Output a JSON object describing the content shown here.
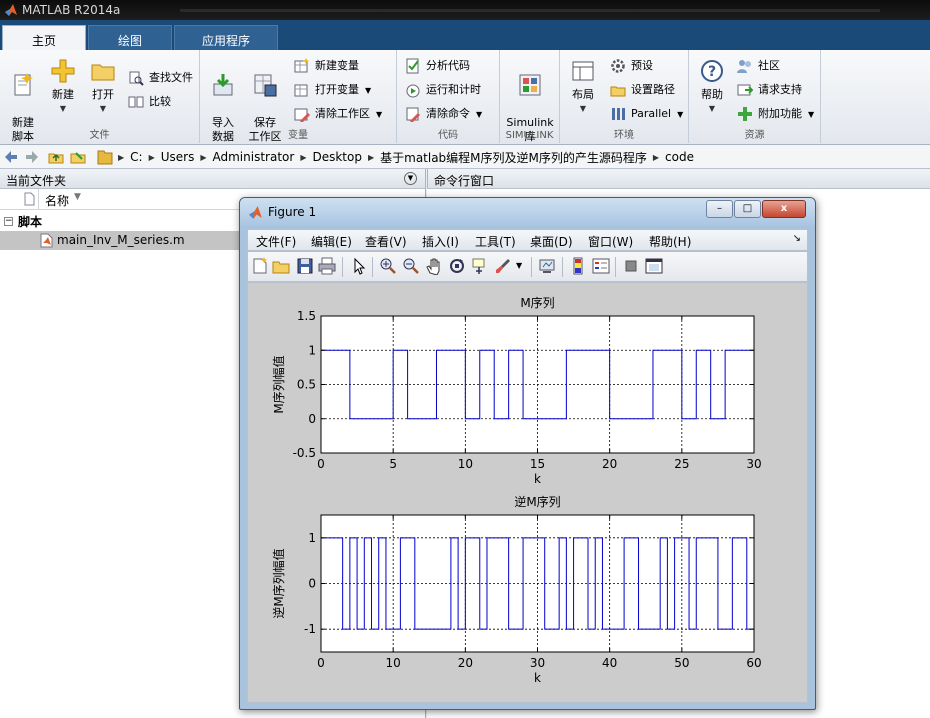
{
  "app": {
    "title": "MATLAB R2014a"
  },
  "tabs": [
    {
      "label": "主页",
      "active": true
    },
    {
      "label": "绘图",
      "active": false
    },
    {
      "label": "应用程序",
      "active": false
    }
  ],
  "ribbon": {
    "file": {
      "label": "文件",
      "new_script": "新建\n脚本",
      "new": "新建",
      "open": "打开",
      "find_files": "查找文件",
      "compare": "比较"
    },
    "variable": {
      "label": "变量",
      "import": "导入\n数据",
      "save_workspace": "保存\n工作区",
      "new_variable": "新建变量",
      "open_variable": "打开变量",
      "clear_workspace": "清除工作区"
    },
    "code": {
      "label": "代码",
      "analyze": "分析代码",
      "run_time": "运行和计时",
      "clear_commands": "清除命令"
    },
    "simulink": {
      "label": "SIMULINK",
      "button": "Simulink\n库"
    },
    "environment": {
      "label": "环境",
      "layout": "布局",
      "preferences": "预设",
      "set_path": "设置路径",
      "parallel": "Parallel"
    },
    "resources": {
      "label": "资源",
      "help": "帮助",
      "community": "社区",
      "request_support": "请求支持",
      "addons": "附加功能"
    }
  },
  "path": {
    "crumbs": [
      "C:",
      "Users",
      "Administrator",
      "Desktop",
      "基于matlab编程M序列及逆M序列的产生源码程序",
      "code"
    ]
  },
  "current_folder": {
    "title": "当前文件夹",
    "column_name": "名称",
    "group": "脚本",
    "files": [
      "main_Inv_M_series.m"
    ]
  },
  "command_window": {
    "title": "命令行窗口"
  },
  "figure": {
    "title": "Figure 1",
    "menus": [
      "文件(F)",
      "编辑(E)",
      "查看(V)",
      "插入(I)",
      "工具(T)",
      "桌面(D)",
      "窗口(W)",
      "帮助(H)"
    ],
    "win_buttons": {
      "minimize": "–",
      "maximize": "□",
      "close": "x"
    },
    "menubar_end": "↘"
  },
  "colors": {
    "accent": "#1a4a78",
    "plot_line": "#0000cc",
    "figure_bg": "#cccccc"
  },
  "chart_data": [
    {
      "type": "line",
      "step": true,
      "title": "M序列",
      "xlabel": "k",
      "ylabel": "M序列幅值",
      "xlim": [
        0,
        30
      ],
      "ylim": [
        -0.5,
        1.5
      ],
      "xticks": [
        0,
        5,
        10,
        15,
        20,
        25,
        30
      ],
      "yticks": [
        -0.5,
        0,
        0.5,
        1,
        1.5
      ],
      "grid": true,
      "x": [
        0,
        1,
        2,
        3,
        4,
        5,
        6,
        7,
        8,
        9,
        10,
        11,
        12,
        13,
        14,
        15,
        16,
        17,
        18,
        19,
        20,
        21,
        22,
        23,
        24,
        25,
        26,
        27,
        28,
        29,
        30
      ],
      "values": [
        1,
        1,
        0,
        0,
        0,
        1,
        0,
        0,
        1,
        1,
        0,
        1,
        0,
        1,
        0,
        0,
        0,
        1,
        1,
        1,
        0,
        0,
        0,
        1,
        1,
        0,
        1,
        0,
        1,
        1,
        1
      ]
    },
    {
      "type": "line",
      "step": true,
      "title": "逆M序列",
      "xlabel": "k",
      "ylabel": "逆M序列幅值",
      "xlim": [
        0,
        60
      ],
      "ylim": [
        -1.5,
        1.5
      ],
      "xticks": [
        0,
        10,
        20,
        30,
        40,
        50,
        60
      ],
      "yticks": [
        -1,
        0,
        1
      ],
      "ytick_labels": [
        "-1",
        "0",
        "1"
      ],
      "grid": true,
      "x": [
        0,
        1,
        2,
        3,
        4,
        5,
        6,
        7,
        8,
        9,
        10,
        11,
        12,
        13,
        14,
        15,
        16,
        17,
        18,
        19,
        20,
        21,
        22,
        23,
        24,
        25,
        26,
        27,
        28,
        29,
        30,
        31,
        32,
        33,
        34,
        35,
        36,
        37,
        38,
        39,
        40,
        41,
        42,
        43,
        44,
        45,
        46,
        47,
        48,
        49,
        50,
        51,
        52,
        53,
        54,
        55,
        56,
        57,
        58,
        59,
        60
      ],
      "values": [
        1,
        1,
        1,
        -1,
        1,
        -1,
        1,
        -1,
        1,
        -1,
        -1,
        1,
        1,
        -1,
        -1,
        -1,
        -1,
        -1,
        1,
        -1,
        1,
        1,
        -1,
        1,
        1,
        1,
        -1,
        -1,
        1,
        1,
        1,
        -1,
        -1,
        1,
        -1,
        1,
        1,
        -1,
        1,
        -1,
        -1,
        -1,
        1,
        1,
        -1,
        -1,
        -1,
        1,
        -1,
        1,
        1,
        -1,
        1,
        1,
        1,
        -1,
        -1,
        1,
        1,
        -1,
        1
      ]
    }
  ]
}
